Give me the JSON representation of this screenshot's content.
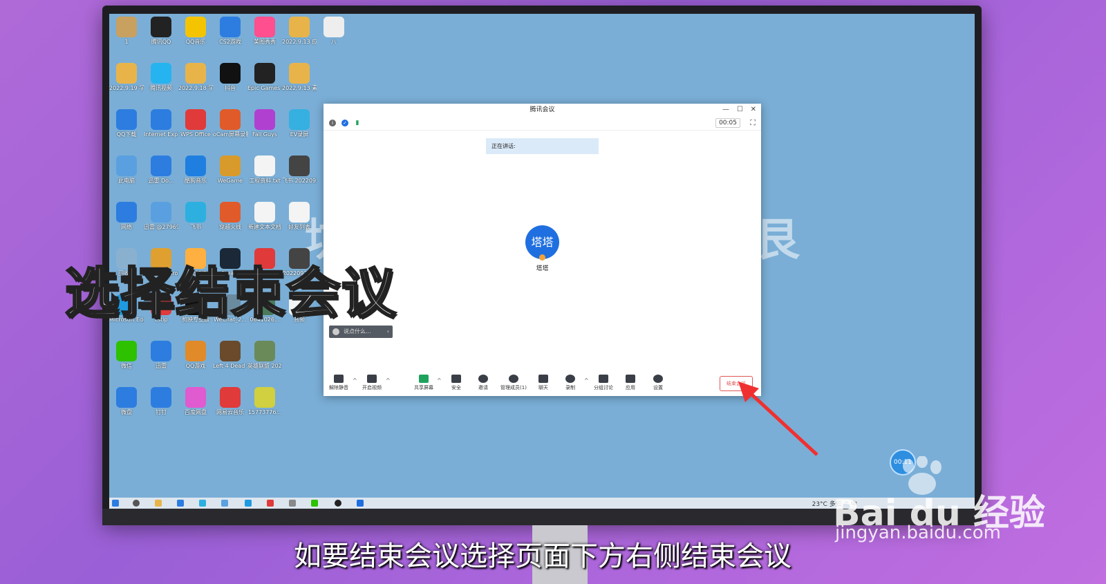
{
  "desktop": {
    "icons": [
      {
        "label": "1",
        "color": "#c8a060"
      },
      {
        "label": "腾讯QQ",
        "color": "#222"
      },
      {
        "label": "QQ音乐",
        "color": "#f5c400"
      },
      {
        "label": "CS2游戏",
        "color": "#2d7de0"
      },
      {
        "label": "美图秀秀",
        "color": "#ff4f8e"
      },
      {
        "label": "2022.9.13 应用教程（...",
        "color": "#e8b44a"
      },
      {
        "label": "八",
        "color": "#eee"
      },
      {
        "label": "2022.9.19 学习 1图",
        "color": "#e8b44a"
      },
      {
        "label": "腾讯视频",
        "color": "#25b4f0"
      },
      {
        "label": "2022.9.18 学习 ",
        "color": "#e8b44a"
      },
      {
        "label": "抖音",
        "color": "#111"
      },
      {
        "label": "Epic Games Launcher",
        "color": "#222"
      },
      {
        "label": "2022.9.13 素材 (1)",
        "color": "#e8b44a"
      },
      {
        "label": "QQ下载",
        "color": "#2d7de0"
      },
      {
        "label": "Internet Explorer",
        "color": "#2d7de0"
      },
      {
        "label": "WPS Office",
        "color": "#e03a3a"
      },
      {
        "label": "oCam屏幕录制",
        "color": "#e05a2a"
      },
      {
        "label": "Fall Guys",
        "color": "#b040d0"
      },
      {
        "label": "EV录屏",
        "color": "#35b0e0"
      },
      {
        "label": "此电脑",
        "color": "#5aa0e0"
      },
      {
        "label": "迅雷 Do...",
        "color": "#2d7de0"
      },
      {
        "label": "酷狗音乐",
        "color": "#1f7fe0"
      },
      {
        "label": "WeGame",
        "color": "#d89a2a"
      },
      {
        "label": "工程资料.txt",
        "color": "#f4f4f4"
      },
      {
        "label": "飞书 20220920...",
        "color": "#444"
      },
      {
        "label": "网络",
        "color": "#2d7de0"
      },
      {
        "label": "迅雷 @279694...",
        "color": "#5aa0e0"
      },
      {
        "label": "飞书",
        "color": "#2db0e0"
      },
      {
        "label": "穿越火线",
        "color": "#e05a2a"
      },
      {
        "label": "新建文本文档",
        "color": "#f4f4f4"
      },
      {
        "label": "好友列表",
        "color": "#f4f4f4"
      },
      {
        "label": "回收站",
        "color": "#8ab0d0"
      },
      {
        "label": "Google Chrome",
        "color": "#e0a030"
      },
      {
        "label": "极光加速",
        "color": "#ffb040"
      },
      {
        "label": "Steam",
        "color": "#1b2838"
      },
      {
        "label": "全民K歌",
        "color": "#e03a3a"
      },
      {
        "label": "20220920...",
        "color": "#444"
      },
      {
        "label": "Microsoft Edge",
        "color": "#1f9ae0"
      },
      {
        "label": "cstip",
        "color": "#e03a3a"
      },
      {
        "label": "剪映专业版",
        "color": "#111"
      },
      {
        "label": "WeChat_2...",
        "color": "#6a8aa0"
      },
      {
        "label": "0641026...",
        "color": "#4a7a5a"
      },
      {
        "label": "音频",
        "color": "#f4f4f4"
      },
      {
        "label": "微信",
        "color": "#2dc100"
      },
      {
        "label": "迅雷",
        "color": "#2d7de0"
      },
      {
        "label": "QQ游戏",
        "color": "#e08a2a"
      },
      {
        "label": "Left 4 Dead 2",
        "color": "#6a4a2a"
      },
      {
        "label": "英雄联盟 2022050...",
        "color": "#6a8a5a"
      },
      {
        "label": "微盘",
        "color": "#2d7de0"
      },
      {
        "label": "钉钉",
        "color": "#2d7de0"
      },
      {
        "label": "百度网盘",
        "color": "#e05ad0"
      },
      {
        "label": "网易云音乐",
        "color": "#e03a3a"
      },
      {
        "label": "15773776...",
        "color": "#d0d040"
      }
    ],
    "bg_text_left": "坊",
    "bg_text_right": "艮",
    "tray_text": "23°C 多云  ^  中"
  },
  "meeting": {
    "window_title": "腾讯会议",
    "timer": "00:05",
    "speaking_label": "正在讲话:",
    "avatar_text": "塔塔",
    "username": "塔塔",
    "chat_placeholder": "说点什么...",
    "toolbar": {
      "unmute": "解除静音",
      "start_video": "开启视频",
      "share_screen": "共享屏幕",
      "security": "安全",
      "invite": "邀请",
      "manage_members": "管理成员(1)",
      "chat": "聊天",
      "record": "录制",
      "breakout": "分组讨论",
      "apps": "应用",
      "settings": "设置",
      "end_meeting": "结束会议"
    }
  },
  "recording_badge": "00:11",
  "overlay": {
    "title": "选择结束会议",
    "subtitle": "如要结束会议选择页面下方右侧结束会议"
  },
  "watermark": {
    "brand": "Bai du 经验",
    "url": "jingyan.baidu.com"
  },
  "colors": {
    "accent": "#1f6fe0",
    "end_button": "#e05656",
    "desktop_bg": "#7aaed6"
  }
}
